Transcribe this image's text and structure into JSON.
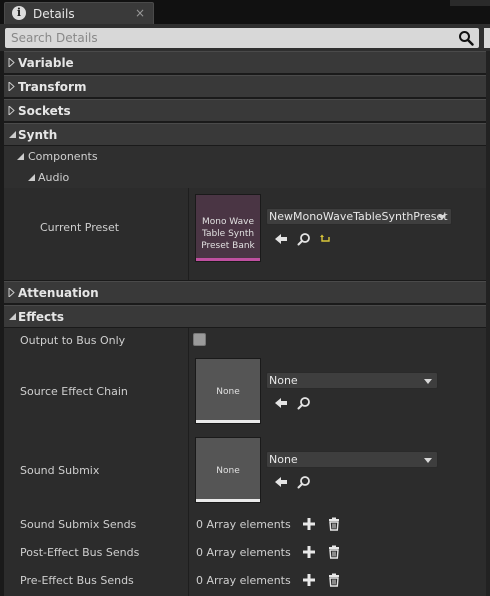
{
  "window": {
    "tab_title": "Details"
  },
  "search": {
    "placeholder": "Search Details"
  },
  "categories": {
    "variable": "Variable",
    "transform": "Transform",
    "sockets": "Sockets",
    "synth": "Synth",
    "attenuation": "Attenuation",
    "effects": "Effects"
  },
  "synth": {
    "components_label": "Components",
    "audio_label": "Audio",
    "current_preset": {
      "label": "Current Preset",
      "thumbnail_text": [
        "Mono Wave",
        "Table Synth",
        "Preset Bank"
      ],
      "value": "NewMonoWaveTableSynthPreset"
    }
  },
  "effects": {
    "output_to_bus_only": {
      "label": "Output to Bus Only",
      "checked": false
    },
    "source_effect_chain": {
      "label": "Source Effect Chain",
      "thumbnail_text": "None",
      "value": "None"
    },
    "sound_submix": {
      "label": "Sound Submix",
      "thumbnail_text": "None",
      "value": "None"
    },
    "sound_submix_sends": {
      "label": "Sound Submix Sends",
      "value": "0 Array elements"
    },
    "post_effect_bus_sends": {
      "label": "Post-Effect Bus Sends",
      "value": "0 Array elements"
    },
    "pre_effect_bus_sends": {
      "label": "Pre-Effect Bus Sends",
      "value": "0 Array elements"
    }
  },
  "colors": {
    "accent_preset": "#c050a0",
    "reset_arrow": "#d9c63a"
  }
}
